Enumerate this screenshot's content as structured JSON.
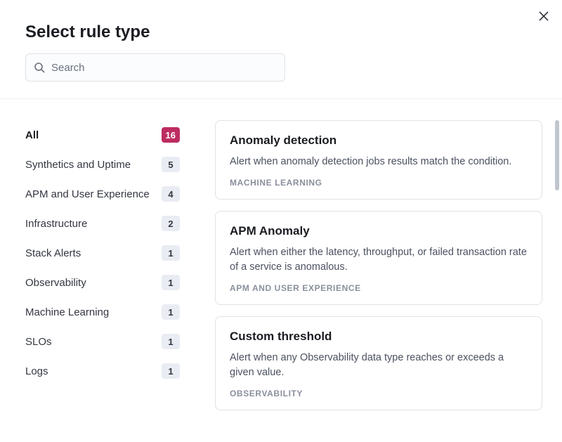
{
  "header": {
    "title": "Select rule type"
  },
  "search": {
    "placeholder": "Search"
  },
  "sidebar": {
    "items": [
      {
        "label": "All",
        "count": "16",
        "active": true
      },
      {
        "label": "Synthetics and Uptime",
        "count": "5",
        "active": false
      },
      {
        "label": "APM and User Experience",
        "count": "4",
        "active": false
      },
      {
        "label": "Infrastructure",
        "count": "2",
        "active": false
      },
      {
        "label": "Stack Alerts",
        "count": "1",
        "active": false
      },
      {
        "label": "Observability",
        "count": "1",
        "active": false
      },
      {
        "label": "Machine Learning",
        "count": "1",
        "active": false
      },
      {
        "label": "SLOs",
        "count": "1",
        "active": false
      },
      {
        "label": "Logs",
        "count": "1",
        "active": false
      }
    ]
  },
  "rules": [
    {
      "title": "Anomaly detection",
      "description": "Alert when anomaly detection jobs results match the condition.",
      "category": "MACHINE LEARNING"
    },
    {
      "title": "APM Anomaly",
      "description": "Alert when either the latency, throughput, or failed transaction rate of a service is anomalous.",
      "category": "APM AND USER EXPERIENCE"
    },
    {
      "title": "Custom threshold",
      "description": "Alert when any Observability data type reaches or exceeds a given value.",
      "category": "OBSERVABILITY"
    }
  ]
}
